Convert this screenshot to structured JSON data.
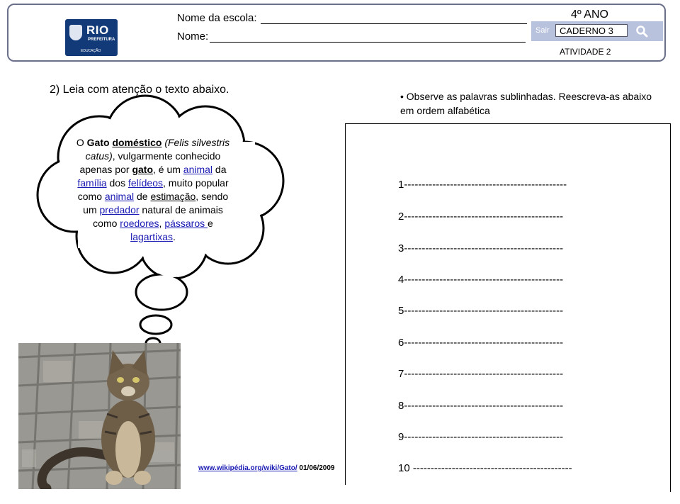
{
  "header": {
    "logo": {
      "brand": "RIO",
      "sub": "PREFEITURA",
      "dept": "EDUCAÇÃO"
    },
    "school_label": "Nome da escola:",
    "name_label": "Nome:",
    "grade": "4º ANO",
    "exit_label": "Sair",
    "notebook": "CADERNO 3",
    "activity": "ATIVIDADE 2"
  },
  "question": "2) Leia com atenção o texto abaixo.",
  "instruction": "• Observe as palavras sublinhadas. Reescreva-as abaixo em ordem alfabética",
  "cloud": {
    "t1": "O ",
    "gato_bold": "Gato",
    "t2": " ",
    "domestico": "doméstico",
    "t3": " (Felis silvestris catus)",
    "t4": ", vulgarmente conhecido apenas por ",
    "gato": "gato",
    "t5": ", é um ",
    "animal1": "animal",
    "t6": " da ",
    "familia": "família",
    "t7": " dos ",
    "felideos": "felídeos",
    "t8": ", muito popular como ",
    "animal2": "animal",
    "t9": " de ",
    "estimacao": "estimação",
    "t10": ", sendo um ",
    "predador": "predador",
    "t11": " natural de animais como ",
    "roedores": "roedores",
    "t12": ", ",
    "passaros": "pássaros ",
    "t13": "e ",
    "lagartixas": "lagartixas",
    "t14": "."
  },
  "credit": {
    "link": "www.wikipédia.org/wiki/Gato/",
    "date": " 01/06/2009"
  },
  "answer_lines": [
    "1----------------------------------------------",
    "2---------------------------------------------",
    "3---------------------------------------------",
    "4---------------------------------------------",
    "5---------------------------------------------",
    "6---------------------------------------------",
    "7---------------------------------------------",
    "8---------------------------------------------",
    "9---------------------------------------------",
    "10 ---------------------------------------------"
  ]
}
